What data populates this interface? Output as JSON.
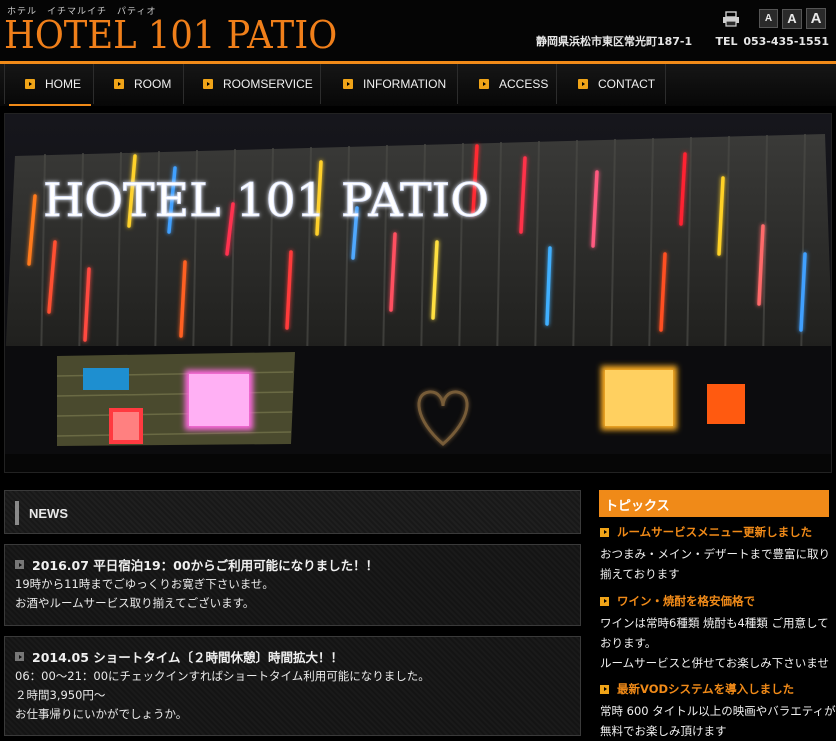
{
  "header": {
    "kana": "ホテル　イチマルイチ　パティオ",
    "logo": "HOTEL 101 PATIO",
    "font_buttons": [
      "A",
      "A",
      "A"
    ],
    "address": "静岡県浜松市東区常光町187-1",
    "tel": "TEL 053-435-1551",
    "icons": {
      "print": "printer-icon"
    }
  },
  "nav": {
    "items": [
      {
        "label": "HOME",
        "active": true
      },
      {
        "label": "ROOM"
      },
      {
        "label": "ROOMSERVICE"
      },
      {
        "label": "INFORMATION"
      },
      {
        "label": "ACCESS"
      },
      {
        "label": "CONTACT"
      }
    ]
  },
  "hero": {
    "sign_text": "HOTEL 101 PATIO"
  },
  "news": {
    "title": "NEWS",
    "items": [
      {
        "title": "2016.07 平日宿泊19：00からご利用可能になりました！！",
        "lines": [
          "19時から11時までごゆっくりお寛ぎ下さいませ。",
          "お酒やルームサービス取り揃えてございます。"
        ]
      },
      {
        "title": "2014.05 ショートタイム〔２時間休憩〕時間拡大！！",
        "lines": [
          "06：00～21：00にチェックインすればショートタイム利用可能になりました。",
          "２時間3,950円～",
          "お仕事帰りにいかがでしょうか。"
        ]
      }
    ]
  },
  "topics": {
    "title": "トピックス",
    "items": [
      {
        "title": "ルームサービスメニュー更新しました",
        "lines": [
          "おつまみ・メイン・デザートまで豊富に取り",
          "揃えております"
        ]
      },
      {
        "title": "ワイン・焼酎を格安価格で",
        "lines": [
          "ワインは常時6種類 焼酎も4種類 ご用意して",
          "おります。",
          "ルームサービスと併せてお楽しみ下さいませ"
        ]
      },
      {
        "title": "最新VODシステムを導入しました",
        "lines": [
          "常時 600 タイトル以上の映画やバラエティが",
          "無料でお楽しみ頂けます"
        ]
      }
    ]
  },
  "colors": {
    "accent": "#f08a18",
    "bullet": "#f0a418",
    "background": "#000000"
  }
}
